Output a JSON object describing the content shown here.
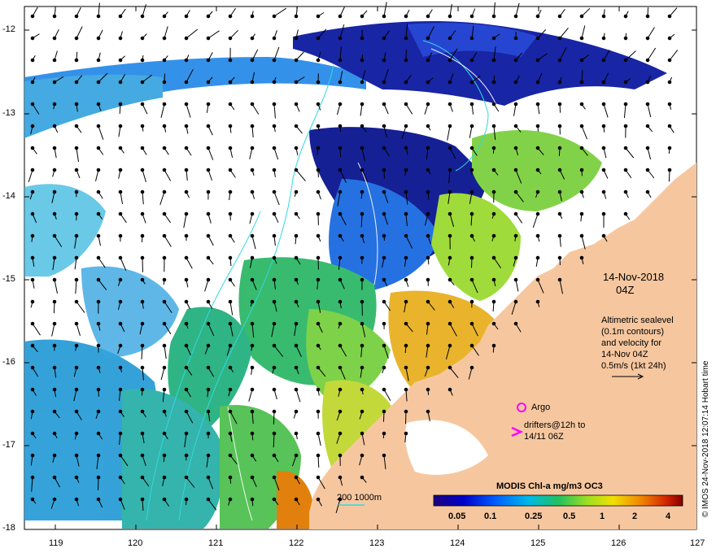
{
  "map": {
    "y_axis": {
      "ticks": [
        "-12",
        "-13",
        "-14",
        "-15",
        "-16",
        "-17",
        "-18"
      ]
    },
    "x_axis": {
      "ticks": [
        "119",
        "120",
        "121",
        "122",
        "123",
        "124",
        "125",
        "126",
        "127"
      ]
    },
    "date_label": "14-Nov-2018",
    "time_label": "04Z",
    "altimetry_text": [
      "Altimetric sealevel",
      "(0.1m contours)",
      "and velocity for",
      "14-Nov 04Z",
      "0.5m/s (1kt 24h)"
    ],
    "argo_label": "Argo",
    "drifters_label": [
      "drifters@12h to",
      "14/11 06Z"
    ],
    "bathymetry_label": "200  1000m",
    "credit": "© IMOS 24-Nov-2018 12:07:14 Hobart time",
    "colorbar": {
      "title": "MODIS Chl-a mg/m3 OC3",
      "ticks": [
        "0.05",
        "0.1",
        "0.25",
        "0.5",
        "1",
        "2",
        "4"
      ]
    },
    "colors": {
      "land": "#f6c79f",
      "low_chl": "#0a1a8f",
      "mid_chl": "#3fbf3f",
      "high_chl": "#e09000",
      "argo": "#ff00ff"
    }
  }
}
